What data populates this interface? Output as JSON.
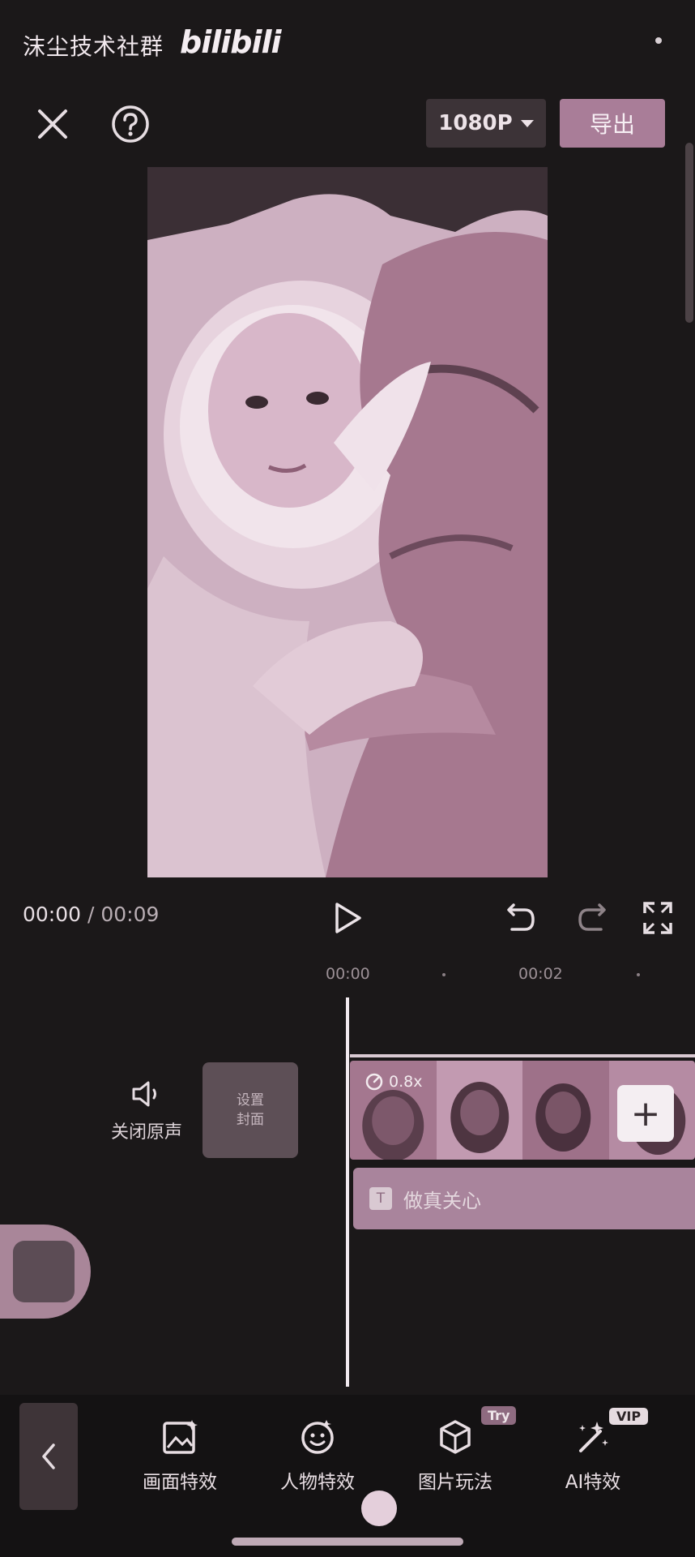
{
  "watermark": {
    "text": "沫尘技术社群",
    "logo": "bilibili"
  },
  "topbar": {
    "resolution": "1080P",
    "export_label": "导出"
  },
  "playback": {
    "current": "00:00",
    "separator": " / ",
    "total": "00:09"
  },
  "timeline": {
    "tick_1": "00:00",
    "tick_2": "00:02"
  },
  "track": {
    "mute_label": "关闭原声",
    "cover_line1": "设置",
    "cover_line2": "封面",
    "speed": "0.8x",
    "text_clip": "做真关心",
    "add_symbol": "+"
  },
  "toolbar": {
    "items": [
      {
        "label": "画面特效",
        "icon": "image-effect-icon"
      },
      {
        "label": "人物特效",
        "icon": "face-effect-icon"
      },
      {
        "label": "图片玩法",
        "icon": "cube-icon",
        "badge": "Try"
      },
      {
        "label": "AI特效",
        "icon": "magic-wand-icon",
        "badge": "VIP"
      }
    ]
  },
  "colors": {
    "accent": "#a97d98",
    "background": "#1b1819",
    "tint": "#cfaec2"
  }
}
